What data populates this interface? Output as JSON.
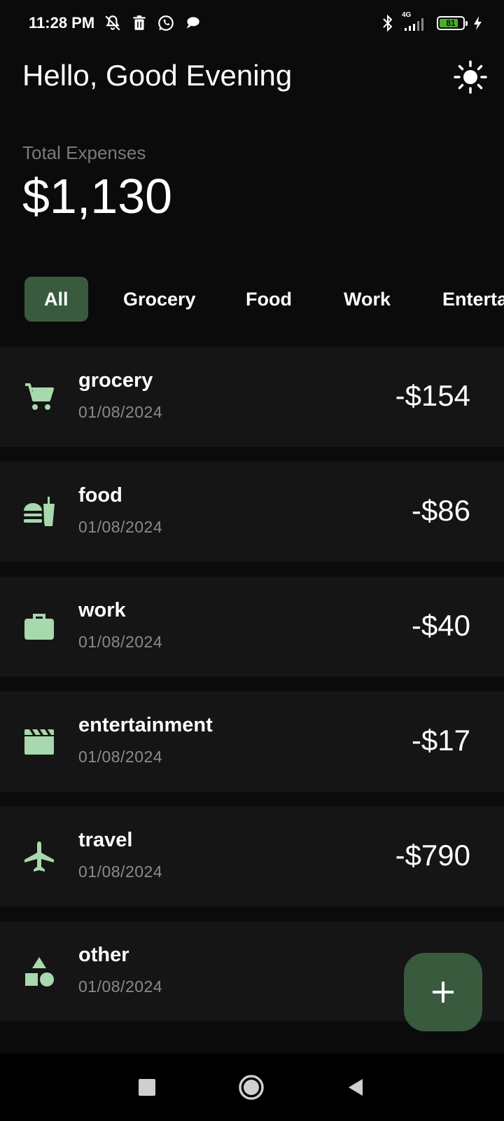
{
  "status_bar": {
    "time": "11:28 PM",
    "network": "4G",
    "battery_level": "81",
    "battery_fraction": 0.81,
    "left_icons": [
      "bell-off-icon",
      "trash-icon",
      "whatsapp-icon",
      "chat-bubble-icon"
    ],
    "right_icons": [
      "bluetooth-icon",
      "signal-icon",
      "battery-icon",
      "charging-icon"
    ]
  },
  "header": {
    "greeting": "Hello, Good Evening",
    "theme_icon": "sun-icon"
  },
  "summary": {
    "label": "Total Expenses",
    "amount": "$1,130"
  },
  "tabs": [
    {
      "label": "All",
      "active": true
    },
    {
      "label": "Grocery",
      "active": false
    },
    {
      "label": "Food",
      "active": false
    },
    {
      "label": "Work",
      "active": false
    },
    {
      "label": "Entertainment",
      "active": false
    }
  ],
  "expenses": [
    {
      "title": "grocery",
      "date": "01/08/2024",
      "amount": "-$154",
      "icon": "shopping-cart-icon"
    },
    {
      "title": "food",
      "date": "01/08/2024",
      "amount": "-$86",
      "icon": "fastfood-icon"
    },
    {
      "title": "work",
      "date": "01/08/2024",
      "amount": "-$40",
      "icon": "briefcase-icon"
    },
    {
      "title": "entertainment",
      "date": "01/08/2024",
      "amount": "-$17",
      "icon": "movie-clapper-icon"
    },
    {
      "title": "travel",
      "date": "01/08/2024",
      "amount": "-$790",
      "icon": "airplane-icon"
    },
    {
      "title": "other",
      "date": "01/08/2024",
      "amount": "",
      "icon": "shapes-icon"
    }
  ],
  "fab": {
    "icon": "plus-icon"
  },
  "nav": {
    "icons": [
      "recents-square-icon",
      "home-circle-icon",
      "back-triangle-icon"
    ]
  },
  "colors": {
    "background": "#0b0b0b",
    "card": "#151515",
    "accent": "#3a5a3e",
    "icon_green": "#a8d8ad",
    "muted_text": "#7a7a7a"
  }
}
